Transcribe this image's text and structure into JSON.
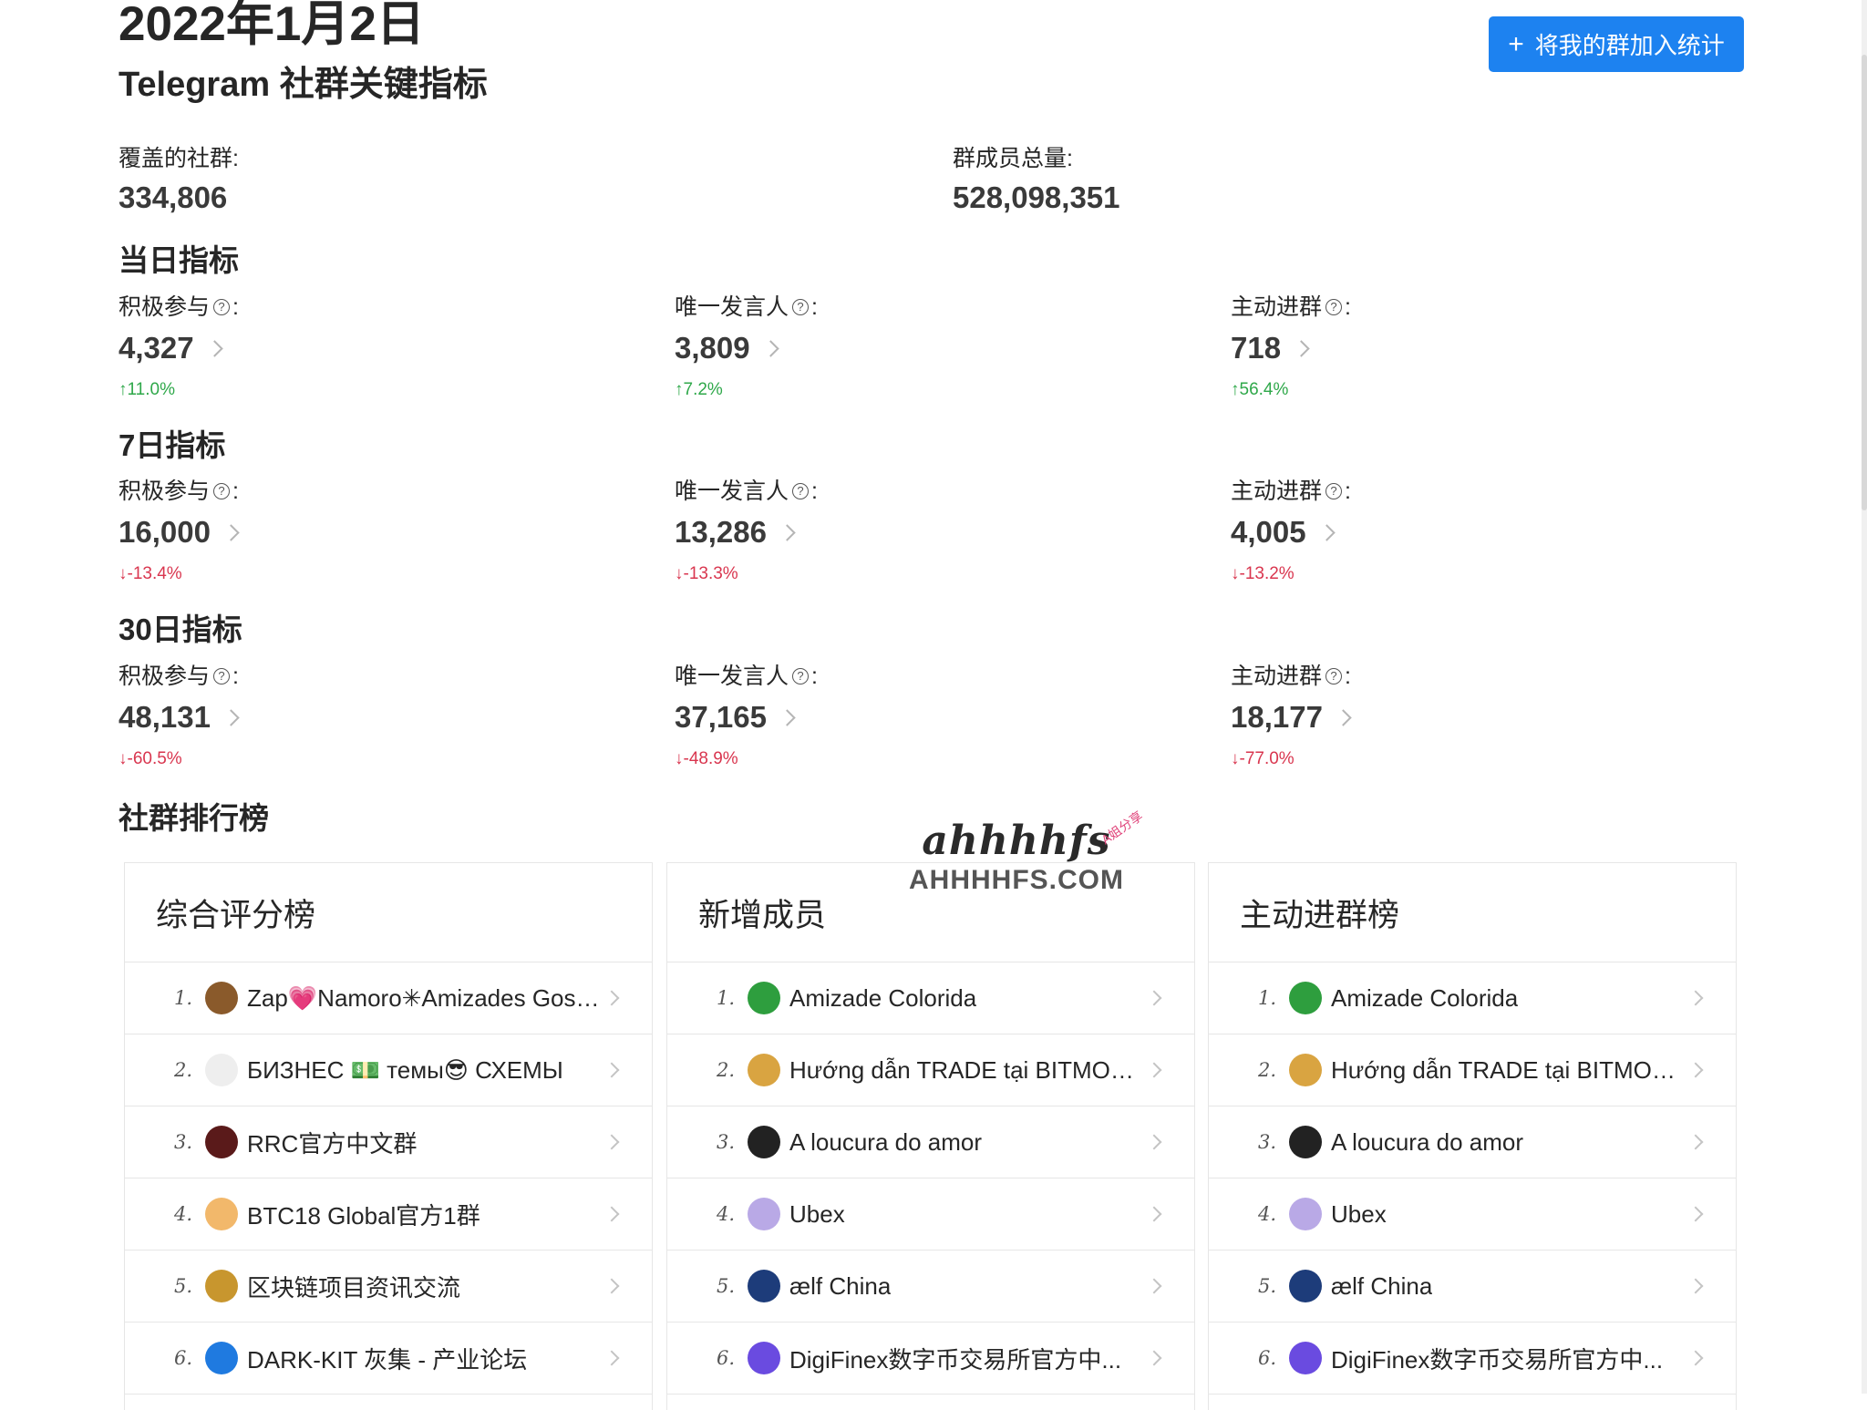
{
  "header": {
    "date": "2022年1月2日",
    "subtitle": "Telegram 社群关键指标",
    "add_button": "将我的群加入统计",
    "accent_color": "#1d82f0"
  },
  "totals": {
    "groups_label": "覆盖的社群:",
    "groups_value": "334,806",
    "members_label": "群成员总量:",
    "members_value": "528,098,351"
  },
  "sections": [
    {
      "title": "当日指标",
      "metrics": [
        {
          "label": "积极参与",
          "value": "4,327",
          "change": "↑11.0%",
          "trend": "up"
        },
        {
          "label": "唯一发言人",
          "value": "3,809",
          "change": "↑7.2%",
          "trend": "up"
        },
        {
          "label": "主动进群",
          "value": "718",
          "change": "↑56.4%",
          "trend": "up"
        }
      ]
    },
    {
      "title": "7日指标",
      "metrics": [
        {
          "label": "积极参与",
          "value": "16,000",
          "change": "↓-13.4%",
          "trend": "down"
        },
        {
          "label": "唯一发言人",
          "value": "13,286",
          "change": "↓-13.3%",
          "trend": "down"
        },
        {
          "label": "主动进群",
          "value": "4,005",
          "change": "↓-13.2%",
          "trend": "down"
        }
      ]
    },
    {
      "title": "30日指标",
      "metrics": [
        {
          "label": "积极参与",
          "value": "48,131",
          "change": "↓-60.5%",
          "trend": "down"
        },
        {
          "label": "唯一发言人",
          "value": "37,165",
          "change": "↓-48.9%",
          "trend": "down"
        },
        {
          "label": "主动进群",
          "value": "18,177",
          "change": "↓-77.0%",
          "trend": "down"
        }
      ]
    }
  ],
  "colon": ":",
  "rankings": {
    "title": "社群排行榜",
    "boards": [
      {
        "title": "综合评分榜",
        "rows": [
          {
            "rank": "1.",
            "name": "Zap💗Namoro✳︎Amizades Gostou fi…",
            "avatar_color": "#8a5a2b"
          },
          {
            "rank": "2.",
            "name": "БИЗНЕС 💵 темы😎 СХЕМЫ",
            "avatar_color": "#eeeeee"
          },
          {
            "rank": "3.",
            "name": "RRC官方中文群",
            "avatar_color": "#5a1a1a"
          },
          {
            "rank": "4.",
            "name": "BTC18 Global官方1群",
            "avatar_color": "#f2b86b"
          },
          {
            "rank": "5.",
            "name": "区块链项目资讯交流",
            "avatar_color": "#c8962e"
          },
          {
            "rank": "6.",
            "name": "DARK-KIT 灰集 - 产业论坛",
            "avatar_color": "#1f7ae0"
          }
        ]
      },
      {
        "title": "新增成员",
        "rows": [
          {
            "rank": "1.",
            "name": "Amizade Colorida",
            "avatar_color": "#2e9e3e"
          },
          {
            "rank": "2.",
            "name": "Hướng dẫn TRADE tại BITMOO...",
            "avatar_color": "#d9a441"
          },
          {
            "rank": "3.",
            "name": "A loucura do amor",
            "avatar_color": "#222222"
          },
          {
            "rank": "4.",
            "name": "Ubex",
            "avatar_color": "#b9a9e6"
          },
          {
            "rank": "5.",
            "name": "ælf China",
            "avatar_color": "#1d3c7a"
          },
          {
            "rank": "6.",
            "name": "DigiFinex数字币交易所官方中...",
            "avatar_color": "#6a4be0"
          }
        ]
      },
      {
        "title": "主动进群榜",
        "rows": [
          {
            "rank": "1.",
            "name": "Amizade Colorida",
            "avatar_color": "#2e9e3e"
          },
          {
            "rank": "2.",
            "name": "Hướng dẫn TRADE tại BITMOO...",
            "avatar_color": "#d9a441"
          },
          {
            "rank": "3.",
            "name": "A loucura do amor",
            "avatar_color": "#222222"
          },
          {
            "rank": "4.",
            "name": "Ubex",
            "avatar_color": "#b9a9e6"
          },
          {
            "rank": "5.",
            "name": "ælf China",
            "avatar_color": "#1d3c7a"
          },
          {
            "rank": "6.",
            "name": "DigiFinex数字币交易所官方中...",
            "avatar_color": "#6a4be0"
          }
        ]
      }
    ]
  },
  "watermark": {
    "top": "ahhhhfs",
    "bottom": "AHHHHFS.COM",
    "tag": "A姐分享"
  }
}
